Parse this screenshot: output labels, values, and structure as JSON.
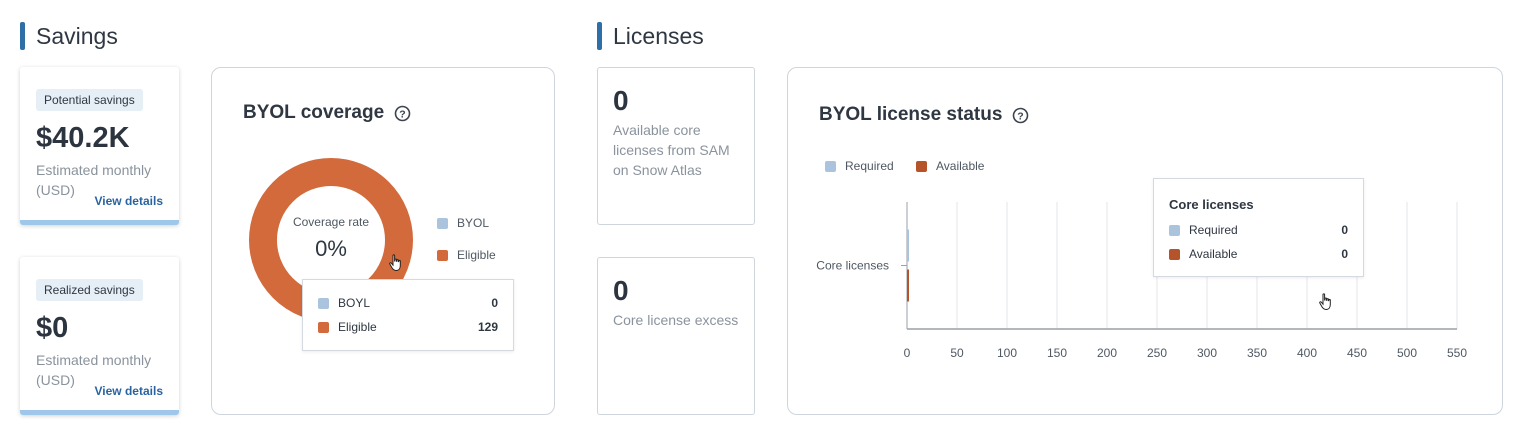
{
  "savings": {
    "section_title": "Savings",
    "potential": {
      "tag": "Potential savings",
      "value": "$40.2K",
      "sub": "Estimated monthly (USD)",
      "link": "View details"
    },
    "realized": {
      "tag": "Realized savings",
      "value": "$0",
      "sub": "Estimated monthly (USD)",
      "link": "View details"
    },
    "coverage": {
      "title": "BYOL coverage",
      "center_label": "Coverage rate",
      "center_value": "0%",
      "legend": [
        {
          "label": "BYOL",
          "color": "#a9c4dc"
        },
        {
          "label": "Eligible",
          "color": "#d26a3b"
        }
      ],
      "tooltip": [
        {
          "label": "BOYL",
          "value": "0",
          "color": "#a9c4dc"
        },
        {
          "label": "Eligible",
          "value": "129",
          "color": "#d26a3b"
        }
      ],
      "chart_data": {
        "type": "pie",
        "labels": [
          "BYOL",
          "Eligible"
        ],
        "values": [
          0,
          129
        ],
        "colors": [
          "#a9c4dc",
          "#d26a3b"
        ],
        "donut": true
      }
    }
  },
  "licenses": {
    "section_title": "Licenses",
    "available": {
      "value": "0",
      "desc": "Available core licenses from SAM on Snow Atlas"
    },
    "excess": {
      "value": "0",
      "desc": "Core license excess"
    },
    "status": {
      "title": "BYOL license status",
      "legend": [
        {
          "label": "Required",
          "color": "#a9c4dc"
        },
        {
          "label": "Available",
          "color": "#b5532a"
        }
      ],
      "tooltip": {
        "title": "Core licenses",
        "rows": [
          {
            "label": "Required",
            "value": "0",
            "color": "#a9c4dc"
          },
          {
            "label": "Available",
            "value": "0",
            "color": "#b5532a"
          }
        ]
      },
      "chart_data": {
        "type": "bar",
        "orientation": "horizontal",
        "categories": [
          "Core licenses"
        ],
        "series": [
          {
            "name": "Required",
            "values": [
              0
            ],
            "color": "#a9c4dc"
          },
          {
            "name": "Available",
            "values": [
              0
            ],
            "color": "#b5532a"
          }
        ],
        "xlim": [
          0,
          550
        ],
        "xticks": [
          0,
          50,
          100,
          150,
          200,
          250,
          300,
          350,
          400,
          450,
          500,
          550
        ],
        "grid": true,
        "legend_position": "top-left"
      }
    }
  }
}
